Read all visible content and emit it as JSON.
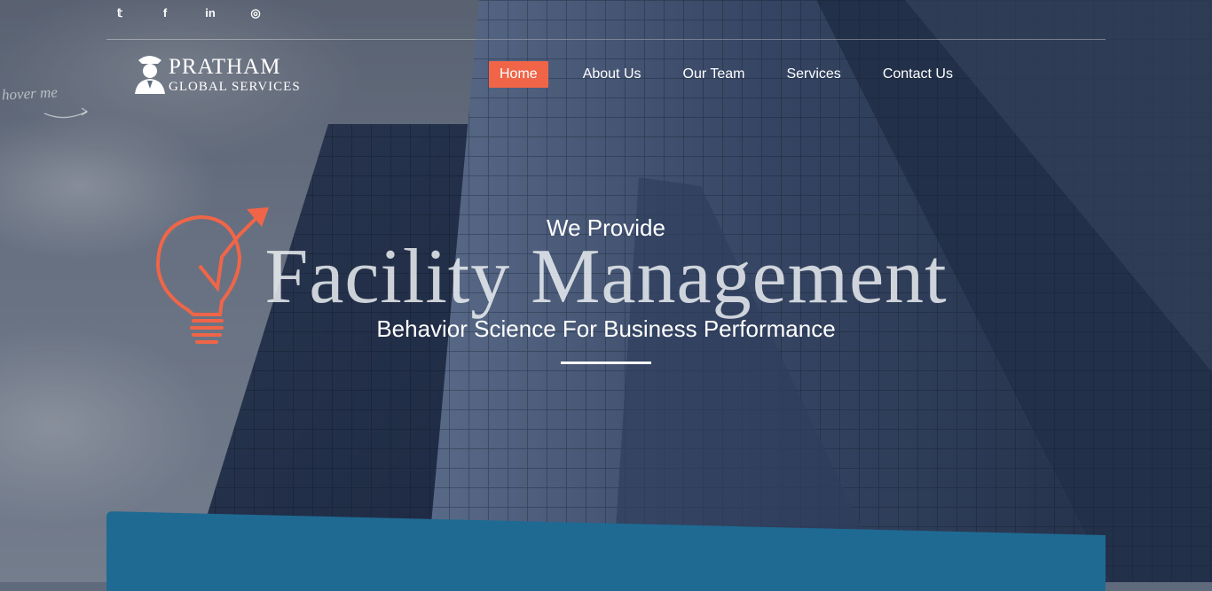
{
  "social": [
    {
      "name": "twitter-icon",
      "glyph": "𝕥"
    },
    {
      "name": "facebook-icon",
      "glyph": "f"
    },
    {
      "name": "linkedin-icon",
      "glyph": "in"
    },
    {
      "name": "instagram-icon",
      "glyph": "◎"
    }
  ],
  "logo": {
    "line1": "PRATHAM",
    "line2": "GLOBAL SERVICES"
  },
  "nav": [
    {
      "label": "Home",
      "active": true
    },
    {
      "label": "About Us"
    },
    {
      "label": "Our Team"
    },
    {
      "label": "Services"
    },
    {
      "label": "Contact Us"
    }
  ],
  "hover_hint": "hover me",
  "hero": {
    "eyebrow": "We Provide",
    "title": "Facility Management",
    "subtitle": "Behavior Science For Business Performance"
  },
  "colors": {
    "accent": "#f06548",
    "panel": "#1f6a93"
  }
}
